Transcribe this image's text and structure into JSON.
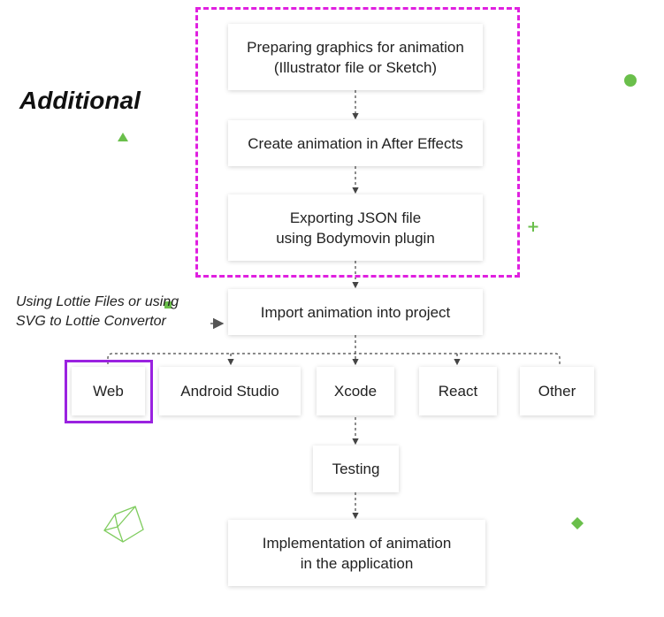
{
  "title": "Additional",
  "note": "Using Lottie Files or using SVG to Lottie Convertor",
  "steps": {
    "prepare": "Preparing graphics for animation\n(Illustrator file or Sketch)",
    "create": "Create animation in After Effects",
    "export": "Exporting JSON file\nusing Bodymovin plugin",
    "import": "Import animation into project",
    "testing": "Testing",
    "implementation": "Implementation of animation\nin the application"
  },
  "platforms": [
    "Web",
    "Android Studio",
    "Xcode",
    "React",
    "Other"
  ],
  "colors": {
    "dashed_highlight": "#e020e0",
    "solid_highlight": "#9a22e0",
    "decor_green": "#6abf4b",
    "connector": "#444444"
  }
}
